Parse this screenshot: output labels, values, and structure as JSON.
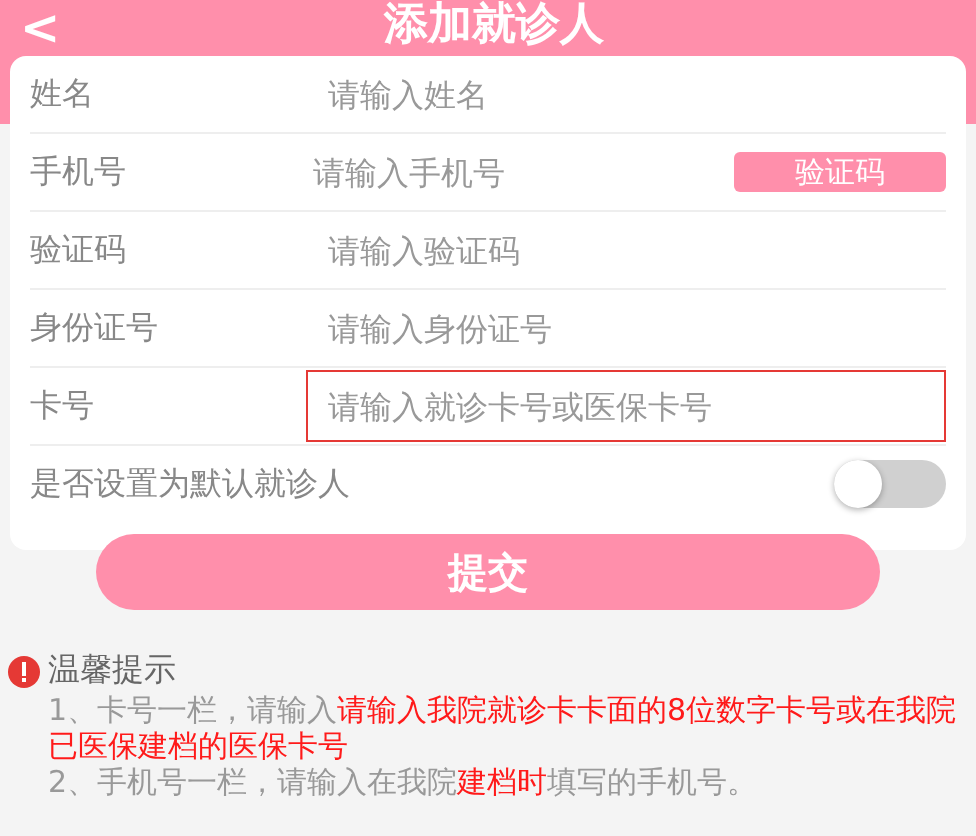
{
  "header": {
    "back": "<",
    "title": "添加就诊人"
  },
  "fields": [
    {
      "label": "姓名",
      "placeholder": "请输入姓名",
      "highlighted": false
    },
    {
      "label": "手机号",
      "placeholder": "请输入手机号",
      "highlighted": false,
      "action": "验证码"
    },
    {
      "label": "验证码",
      "placeholder": "请输入验证码",
      "highlighted": false
    },
    {
      "label": "身份证号",
      "placeholder": "请输入身份证号",
      "highlighted": false
    },
    {
      "label": "卡号",
      "placeholder": "请输入就诊卡号或医保卡号",
      "highlighted": true
    }
  ],
  "default_toggle": {
    "label": "是否设置为默认就诊人",
    "on": false
  },
  "submit": "提交",
  "tips": {
    "title": "温馨提示",
    "items": [
      [
        {
          "text": "1、卡号一栏，请输入",
          "emphasis": false
        },
        {
          "text": "请输入我院就诊卡卡面的8位数字卡号或在我院已医保建档的医保卡号",
          "emphasis": true
        }
      ],
      [
        {
          "text": "2、手机号一栏，请输入在我院",
          "emphasis": false
        },
        {
          "text": "建档时",
          "emphasis": true
        },
        {
          "text": "填写的手机号。",
          "emphasis": false
        }
      ]
    ]
  }
}
